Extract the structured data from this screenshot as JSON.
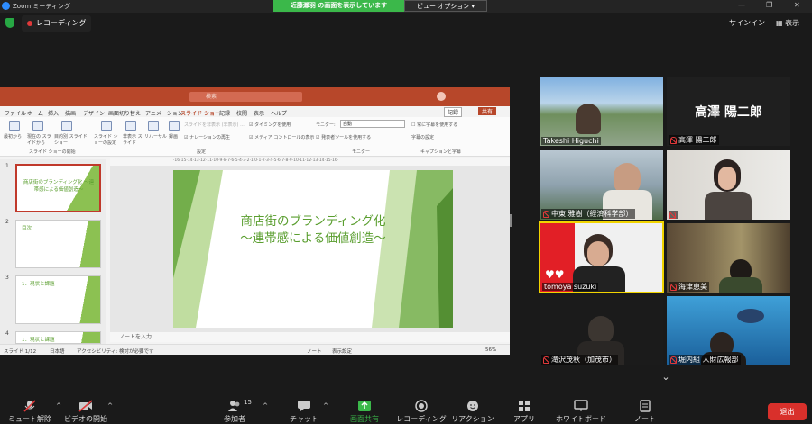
{
  "titlebar": {
    "app_name": "Zoom ミーティング",
    "share_banner": "近藤瀬羽 の画面を表示しています",
    "view_options": "ビュー オプション",
    "min": "—",
    "restore": "❐",
    "close": "✕"
  },
  "topbar": {
    "recording": "レコーディング",
    "signin": "サインイン",
    "view": "表示"
  },
  "ppt": {
    "search": "検索",
    "menu": [
      "ファイル",
      "ホーム",
      "挿入",
      "描画",
      "デザイン",
      "画面切り替え",
      "アニメーション",
      "スライド ショー",
      "記録",
      "校閲",
      "表示",
      "ヘルプ"
    ],
    "record_btn": "記録",
    "share_btn": "共有",
    "ribbon": {
      "btn1": "最初から",
      "btn2": "現在の スライドから",
      "btn3": "目的別 スライド ショー",
      "btn4": "スライド ショーの設定",
      "btn5": "非表示 スライド",
      "btn6": "リハーサル",
      "btn7": "録画",
      "chk1": "スライドを非表示 (非表示) ...",
      "chk2": "タイミングを使用",
      "chk3": "ナレーションの再生",
      "chk4": "メディア コントロールの表示",
      "monitor_label": "モニター:",
      "monitor_value": "自動",
      "presenter": "発表者ツールを使用する",
      "caption_chk": "常に字幕を使用する",
      "caption_settings": "字幕の設定",
      "group1": "スライド ショーの開始",
      "group2": "設定",
      "group3": "モニター",
      "group4": "キャプションと字幕"
    },
    "ruler": "·16·15·14·13·12·11·10·9·8·7·6·5·4·3·2·1·0·1·2·3·4·5·6·7·8·9·10·11·12·13·14·15·16·",
    "slide_title_1": "商店街のブランディング化",
    "slide_title_2": "～連帯感による価値創造～",
    "thumbs": [
      {
        "num": "1",
        "title": "商店街のブランディング化 ～連帯感による価値創造～"
      },
      {
        "num": "2",
        "title": "目次"
      },
      {
        "num": "3",
        "title": "1．現状と課題"
      },
      {
        "num": "4",
        "title": "1．現状と課題"
      }
    ],
    "notes": "ノートを入力",
    "status": {
      "slide": "スライド 1/12",
      "lang": "日本語",
      "access": "アクセシビリティ: 検討が必要です",
      "notes_btn": "ノート",
      "display": "表示設定",
      "zoom": "56%"
    }
  },
  "gallery": [
    {
      "name": "Takeshi Higuchi",
      "muted": false
    },
    {
      "name": "高澤 陽二郎",
      "muted": true,
      "big_text": "高澤 陽二郎"
    },
    {
      "name": "中東 雅樹（経済科学部）",
      "muted": true
    },
    {
      "name": "",
      "muted": true
    },
    {
      "name": "tomoya suzuki",
      "muted": false,
      "highlight": "#f1d400"
    },
    {
      "name": "海津恵美",
      "muted": true
    },
    {
      "name": "滝沢茂秋（加茂市）",
      "muted": true
    },
    {
      "name": "堀内組 人財広報部",
      "muted": true
    }
  ],
  "toolbar": {
    "mute": "ミュート解除",
    "video": "ビデオの開始",
    "participants": "参加者",
    "participants_count": "15",
    "chat": "チャット",
    "share": "画面共有",
    "record": "レコーディング",
    "reactions": "リアクション",
    "apps": "アプリ",
    "whiteboard": "ホワイトボード",
    "notes": "ノート",
    "leave": "退出"
  },
  "colors": {
    "ppt_red": "#b7472a",
    "zoom_green": "#3bb84a",
    "leave_red": "#d9302b",
    "slide_green": "#5a9e2f",
    "speaker_yellow": "#f1d400"
  }
}
